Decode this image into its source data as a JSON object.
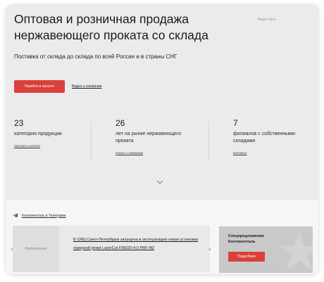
{
  "hero": {
    "title": "Оптовая и розничная продажа нержавеющего проката со склада",
    "video_bg_label": "Видео фон",
    "subtitle": "Поставка от склада до склада по всей России и в страны СНГ",
    "catalog_button": "Перейти в каталог",
    "video_link": "Видео о компании"
  },
  "stats": [
    {
      "number": "23",
      "description": "категории продукции",
      "link": "Смотреть каталог"
    },
    {
      "number": "26",
      "description": "лет на рынке нержавеющего проката",
      "link": "Узнать о компании"
    },
    {
      "number": "7",
      "description": "филиалов с собственными складами",
      "link": "Контакты"
    }
  ],
  "lower": {
    "telegram_link": "Континенталь в Телеграме",
    "news_image_placeholder": "Изображение",
    "news_text": "В СМЦ Санкт-Петербурга запущена в эксплуатацию новая установка лазерной резки LazerCut F06020-4.0 PRF-M2",
    "offer_title": "Спецпредложения Континенталь",
    "offer_button": "Подробнее"
  },
  "colors": {
    "accent": "#d9413a",
    "hero_bg": "#ebebeb",
    "lower_bg": "#f6f6f6"
  },
  "icons": [
    "telegram-icon",
    "chevron-down-icon",
    "star-icon"
  ]
}
